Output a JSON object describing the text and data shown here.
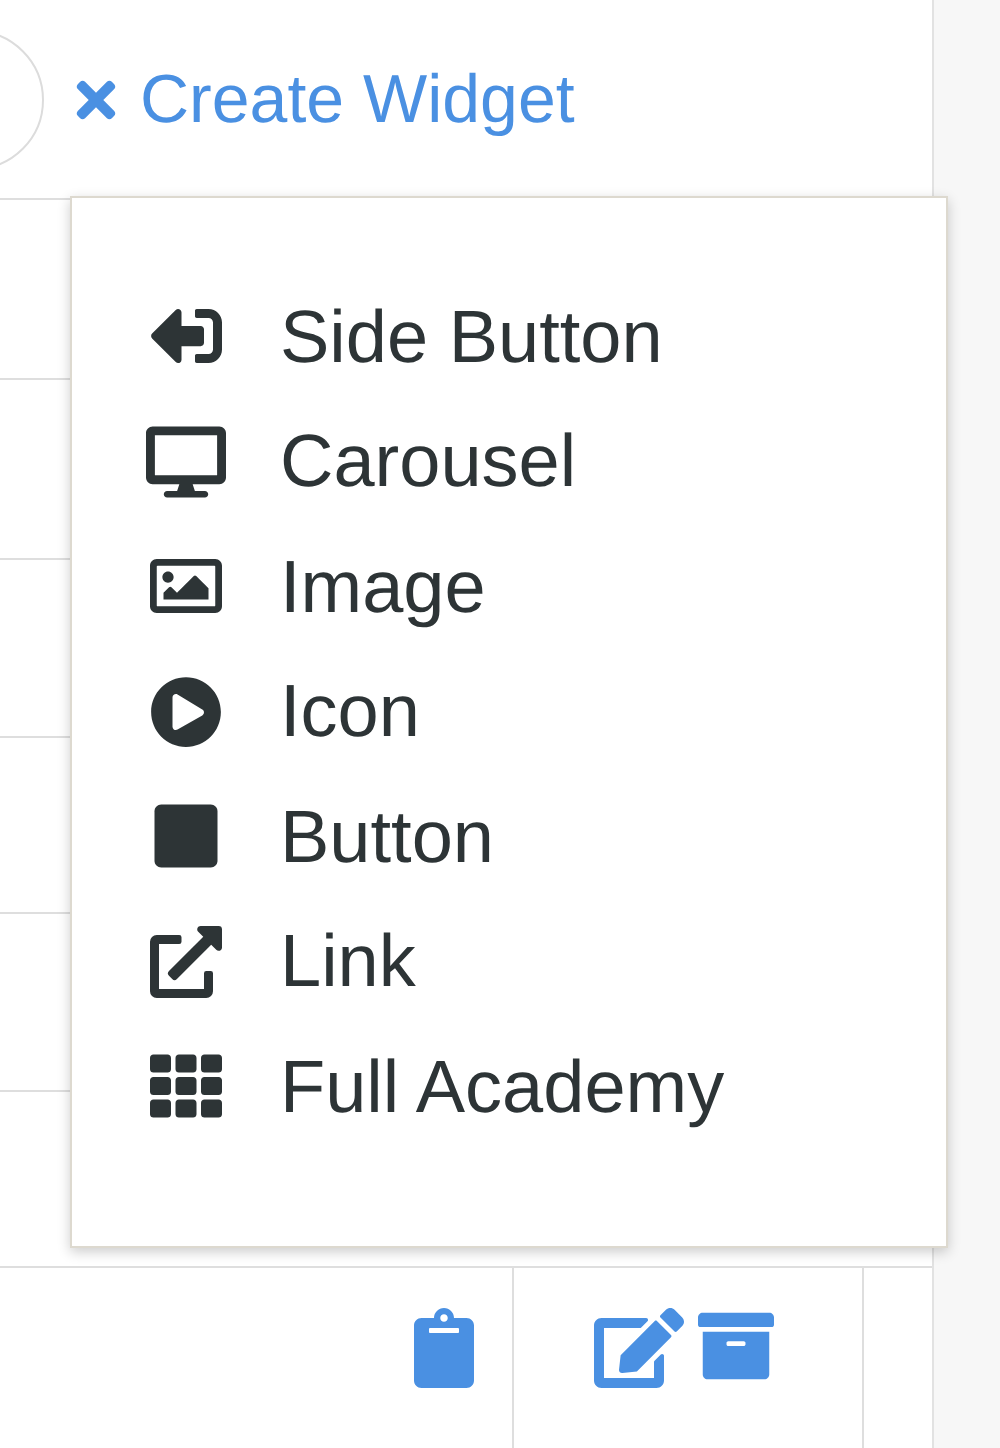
{
  "header": {
    "create_link": "Create Widget"
  },
  "widget_menu": {
    "items": [
      {
        "label": "Side Button"
      },
      {
        "label": "Carousel"
      },
      {
        "label": "Image"
      },
      {
        "label": "Icon"
      },
      {
        "label": "Button"
      },
      {
        "label": "Link"
      },
      {
        "label": "Full Academy"
      }
    ]
  }
}
